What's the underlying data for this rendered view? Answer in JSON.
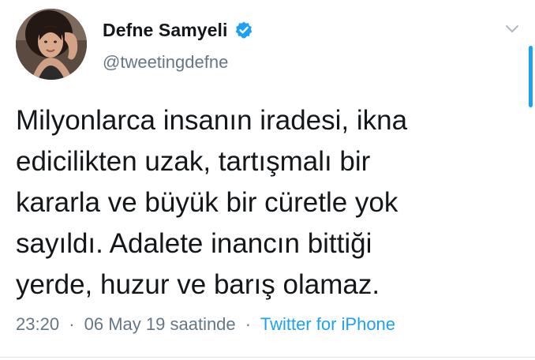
{
  "author": {
    "display_name": "Defne Samyeli",
    "handle": "@tweetingdefne",
    "verified": true,
    "verified_icon": "verified-badge-icon",
    "avatar": "profile-photo"
  },
  "tweet": {
    "text_lines": [
      "Milyonlarca insanın iradesi, ikna",
      "edicilikten uzak, tartışmalı bir",
      "kararla ve büyük bir cüretle yok",
      "sayıldı. Adalete inancın bittiği",
      "yerde, huzur ve barış olamaz."
    ],
    "time": "23:20",
    "date_phrase": "06 May 19 saatinde",
    "separator": "·",
    "source": "Twitter for iPhone"
  },
  "icons": {
    "menu": "chevron-down-icon"
  },
  "colors": {
    "text": "#14171a",
    "secondary": "#657786",
    "link": "#1da1f2",
    "verified": "#1da1f2"
  }
}
